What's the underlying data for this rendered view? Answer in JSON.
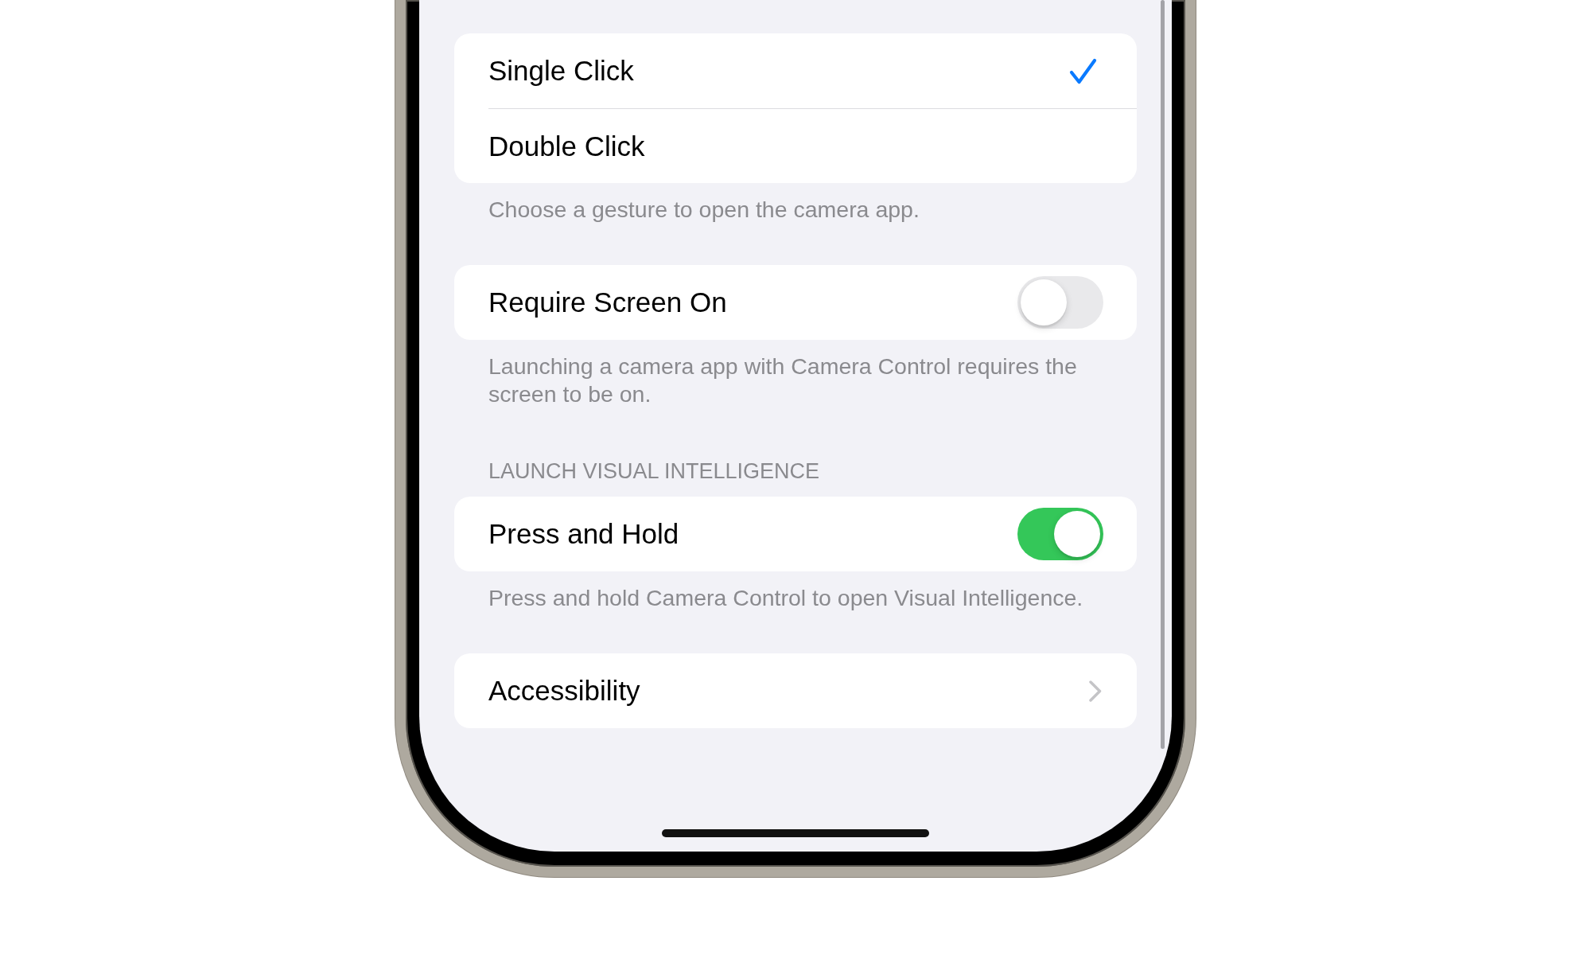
{
  "settings": {
    "sections": [
      {
        "rows": [
          {
            "kind": "choice",
            "label": "Single Click",
            "selected": true
          },
          {
            "kind": "choice",
            "label": "Double Click",
            "selected": false
          }
        ],
        "footer": "Choose a gesture to open the camera app."
      },
      {
        "rows": [
          {
            "kind": "toggle",
            "label": "Require Screen On",
            "on": false
          }
        ],
        "footer": "Launching a camera app with Camera Control requires the screen to be on."
      },
      {
        "header": "LAUNCH VISUAL INTELLIGENCE",
        "rows": [
          {
            "kind": "toggle",
            "label": "Press and Hold",
            "on": true
          }
        ],
        "footer": "Press and hold Camera Control to open Visual Intelligence."
      },
      {
        "rows": [
          {
            "kind": "link",
            "label": "Accessibility"
          }
        ]
      }
    ]
  }
}
